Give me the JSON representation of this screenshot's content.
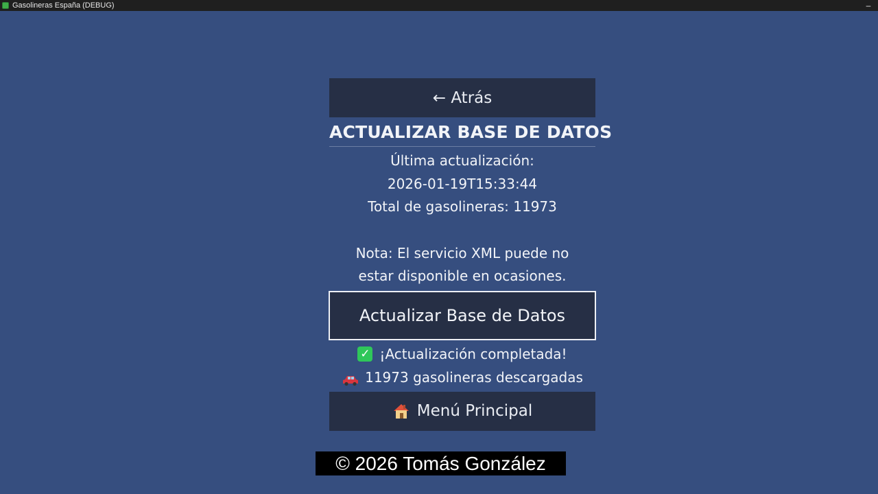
{
  "window": {
    "title": "Gasolineras España (DEBUG)",
    "minimize_glyph": "–"
  },
  "screen": {
    "back_button": "← Atrás",
    "heading": "ACTUALIZAR BASE DE DATOS",
    "last_update_label": "Última actualización:",
    "last_update_value": "2026-01-19T15:33:44",
    "total_stations": "Total de gasolineras: 11973",
    "note_line1": "Nota: El servicio XML puede no",
    "note_line2": "estar disponible en ocasiones.",
    "update_button": "Actualizar Base de Datos",
    "status_success": "¡Actualización completada!",
    "status_downloaded": "11973 gasolineras descargadas",
    "main_menu_button": "Menú Principal"
  },
  "icons": {
    "success": "check-mark-icon",
    "downloaded": "car-icon",
    "main_menu": "house-icon"
  },
  "overlay": {
    "copyright": "© 2026 Tomás González"
  },
  "colors": {
    "background": "#364e7f",
    "button": "#262f45",
    "success_green": "#2fc75a"
  }
}
